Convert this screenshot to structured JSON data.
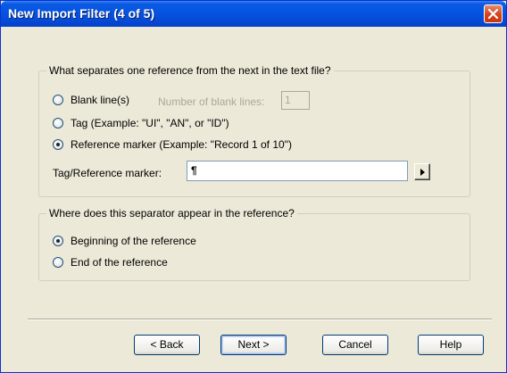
{
  "window": {
    "title": "New Import Filter (4 of 5)"
  },
  "separator_group": {
    "legend": "What separates one reference from the next in the text file?",
    "options": [
      {
        "label": "Blank line(s)",
        "checked": false
      },
      {
        "label": "Tag  (Example:  \"UI\", \"AN\", or \"ID\")",
        "checked": false
      },
      {
        "label": "Reference marker  (Example:  \"Record 1 of 10\")",
        "checked": true
      }
    ],
    "blank_lines_label": "Number of blank lines:",
    "blank_lines_value": "1",
    "marker_label": "Tag/Reference marker:",
    "marker_value": "¶"
  },
  "position_group": {
    "legend": "Where does this separator appear in the reference?",
    "options": [
      {
        "label": "Beginning of the reference",
        "checked": true
      },
      {
        "label": "End of the reference",
        "checked": false
      }
    ]
  },
  "buttons": {
    "back": "< Back",
    "next": "Next >",
    "cancel": "Cancel",
    "help": "Help"
  },
  "icons": {
    "close": "close-icon",
    "arrow": "arrow-right-icon"
  },
  "colors": {
    "titlebar": "#0555e3",
    "close": "#d5411a",
    "dialog_bg": "#ece9d8"
  }
}
